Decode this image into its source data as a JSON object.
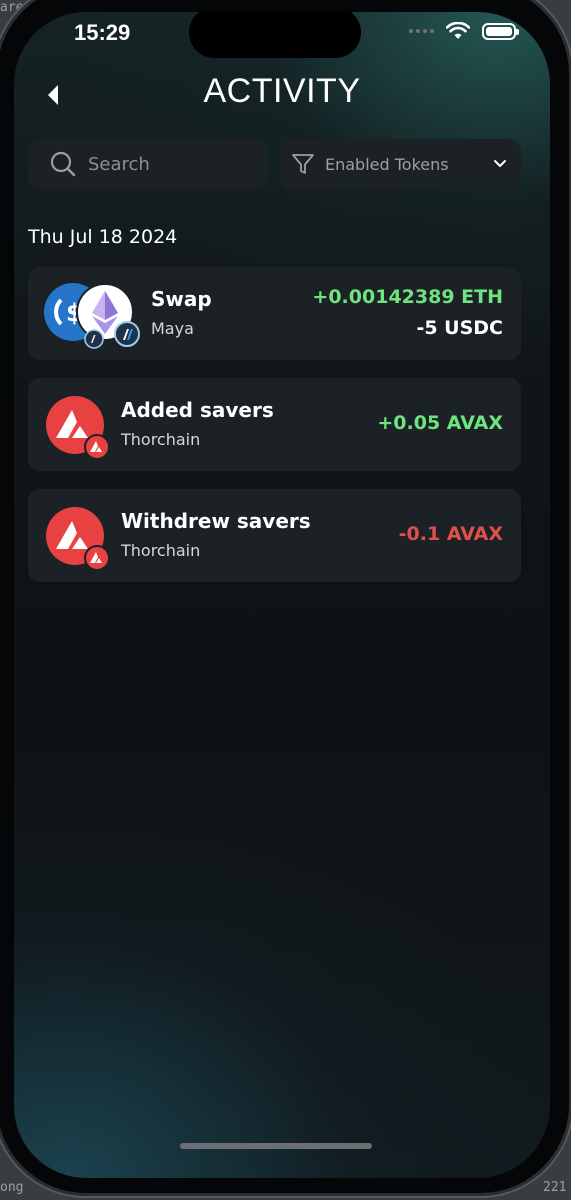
{
  "status_bar": {
    "time": "15:29"
  },
  "header": {
    "title": "ACTIVITY"
  },
  "search": {
    "placeholder": "Search"
  },
  "filter": {
    "label": "Enabled Tokens"
  },
  "date_group": "Thu Jul 18 2024",
  "activities": [
    {
      "name": "Swap",
      "provider": "Maya",
      "amount_in": "+0.00142389 ETH",
      "amount_out": "-5 USDC"
    },
    {
      "name": "Added savers",
      "provider": "Thorchain",
      "amount": "+0.05 AVAX"
    },
    {
      "name": "Withdrew savers",
      "provider": "Thorchain",
      "amount": "-0.1 AVAX"
    }
  ],
  "background_fragments": [
    "are",
    "ong",
    "221"
  ],
  "colors": {
    "positive": "#6ee37f",
    "negative": "#e0504c",
    "card_bg": "#1c2125",
    "avax_red": "#e84142",
    "usdc_blue": "#2775ca"
  }
}
